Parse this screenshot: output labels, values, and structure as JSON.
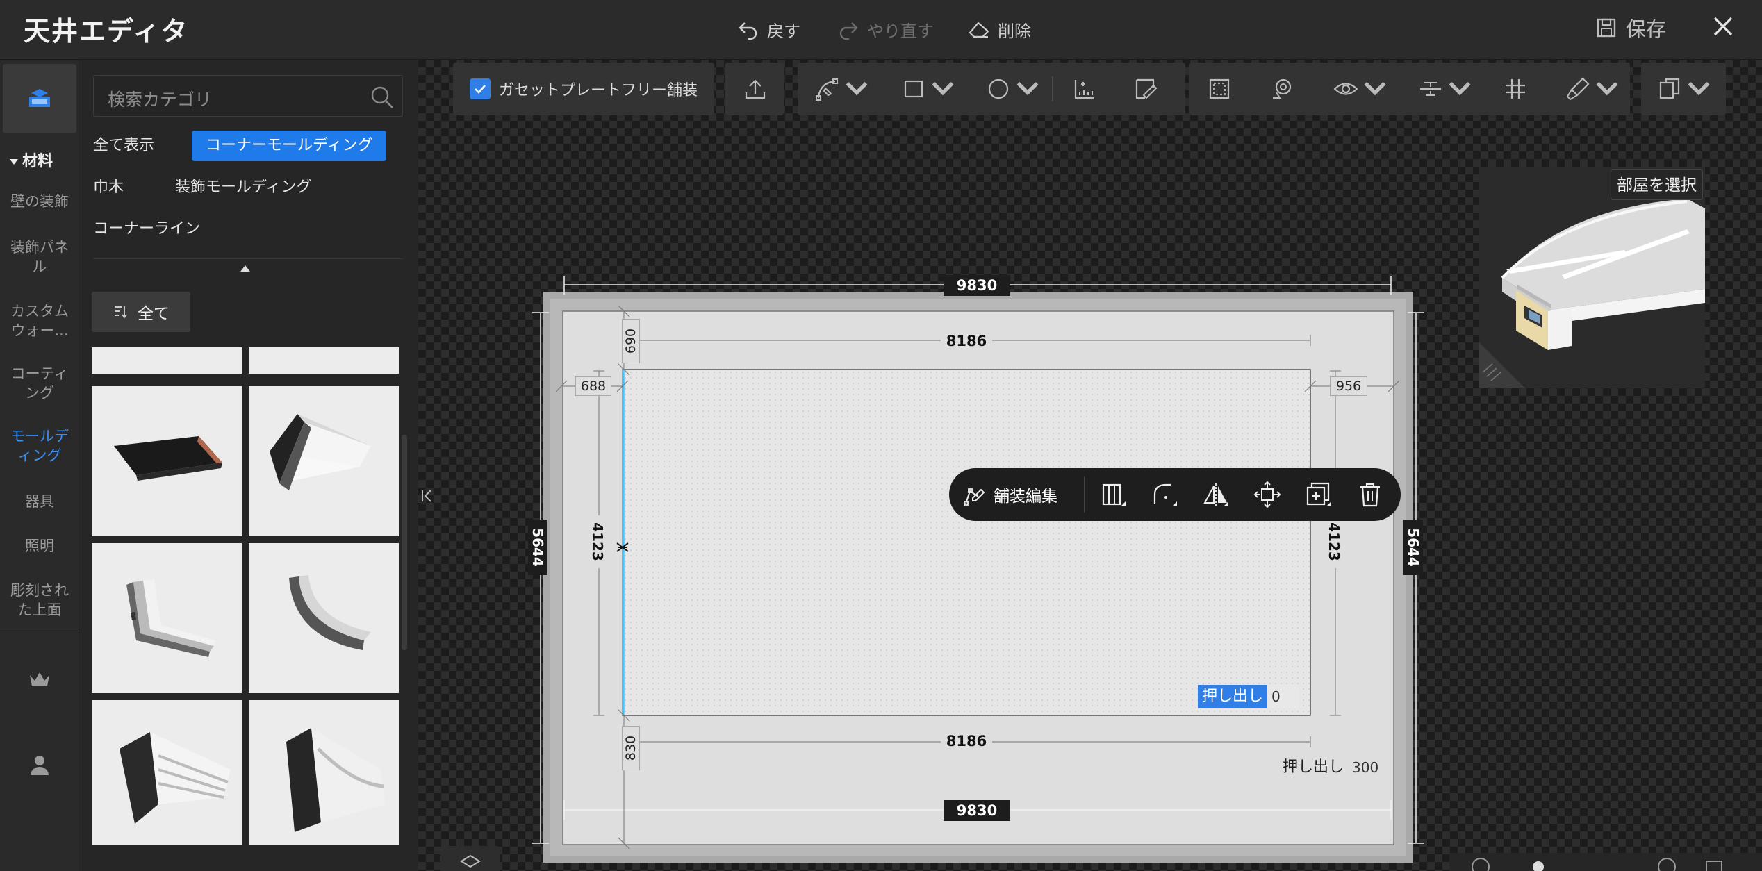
{
  "app": {
    "title": "天井エディタ"
  },
  "titlebar": {
    "undo_label": "戻す",
    "redo_label": "やり直す",
    "delete_label": "削除",
    "save_label": "保存"
  },
  "rail": {
    "section_label": "材料",
    "items": [
      {
        "label": "壁の装飾",
        "active": false
      },
      {
        "label": "装飾パネル",
        "active": false
      },
      {
        "label": "カスタムウォー...",
        "active": false
      },
      {
        "label": "コーティング",
        "active": false
      },
      {
        "label": "モールディング",
        "active": true
      },
      {
        "label": "器具",
        "active": false
      },
      {
        "label": "照明",
        "active": false
      },
      {
        "label": "彫刻された上面",
        "active": false
      }
    ]
  },
  "catalog": {
    "search_placeholder": "検索カテゴリ",
    "chips": [
      "全て表示",
      "コーナーモールディング",
      "巾木",
      "装飾モールディング",
      "コーナーライン"
    ],
    "active_chip": "コーナーモールディング",
    "filter_label": "全て"
  },
  "toolbar": {
    "gusset_label": "ガセットプレートフリー舗装",
    "gusset_checked": true
  },
  "preview": {
    "room_select_label": "部屋を選択"
  },
  "floatbar": {
    "edit_label": "舗装編集"
  },
  "plan": {
    "outer_width": "9830",
    "inner_width_top": "8186",
    "inner_width_bottom": "8186",
    "outer_height": "5644",
    "inner_height_left": "4123",
    "inner_height_right": "4123",
    "offset_top": "690",
    "offset_left": "688",
    "offset_right": "956",
    "offset_bottom": "830",
    "extrude_inner_label": "押し出し",
    "extrude_inner_value": "0",
    "extrude_outer_label": "押し出し",
    "extrude_outer_value": "300"
  },
  "colors": {
    "accent": "#1f7bea",
    "selection_edge": "#4fc3f7",
    "panel_bg": "#262626"
  }
}
